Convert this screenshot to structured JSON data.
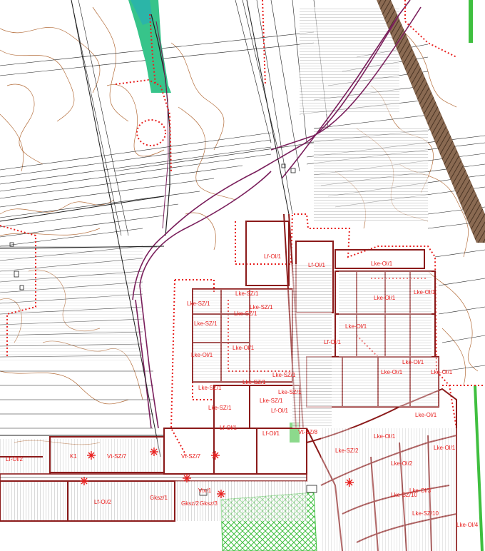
{
  "map": {
    "zone_labels": [
      "Lf-Ol/1",
      "Lf-Ol/1",
      "Lf-Ol/1",
      "Lf-Ol/1",
      "Lf-Ol/1",
      "Lf-Ol/1",
      "Lke-SZ/1",
      "Lke-SZ/1",
      "Lke-SZ/1",
      "Lke-SZ/1",
      "Lke-SZ/1",
      "Lke-SZ/1",
      "Lke-SZ/1",
      "Lke-SZ/1",
      "Lke-SZ/1",
      "Lke-SZ/1",
      "Lke-SZ/1",
      "Lke-Ol/1",
      "Lke-Ol/1",
      "Lke-Ol/1",
      "Lke-Ol/1",
      "Lke-Ol/1",
      "Lke-Ol/1",
      "Lke-Ol/1",
      "Lke-Ol/1",
      "Lke-Ol/1",
      "Lke-Ol/1",
      "Lke-Ol/1",
      "Lke-Ol/1",
      "Lke-Ol/2",
      "Lf-Ol/2",
      "Lf-Ol/2",
      "K1",
      "Vt-SZ/7",
      "Vt-SZ/7",
      "Vt-SZ/8",
      "Gksz/1",
      "Gksz/2",
      "Gksz/3",
      "Vtv/1",
      "Lke-SZ/10",
      "Lke-SZ/10",
      "Lke-SZ/2",
      "Lke-Ol/3",
      "Lke-Ol/4"
    ],
    "colors": {
      "zone_red": "#e8201f",
      "parcel_line": "#1f1f1f",
      "contour": "#b46e3c",
      "road_purple": "#7a1f5c",
      "planned_block": "#8b1a1a",
      "water_green": "#2aa86a",
      "water_teal": "#2bb5a8",
      "forest_green": "#3fbf3f",
      "rail_brown": "#7a5a43"
    }
  }
}
